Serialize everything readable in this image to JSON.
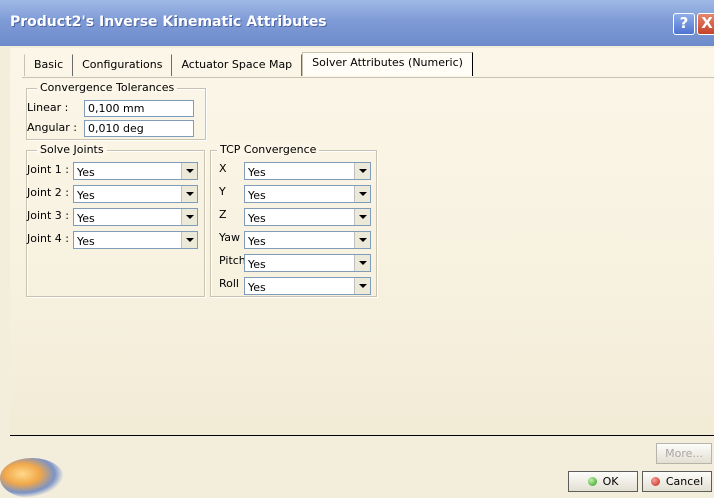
{
  "window": {
    "title": "Product2's Inverse Kinematic Attributes",
    "help_label": "?",
    "close_label": "X"
  },
  "tabs": [
    {
      "label": "Basic",
      "active": false
    },
    {
      "label": "Configurations",
      "active": false
    },
    {
      "label": "Actuator Space Map",
      "active": false
    },
    {
      "label": "Solver Attributes (Numeric)",
      "active": true
    }
  ],
  "convergence": {
    "group_label": "Convergence Tolerances",
    "linear_label": "Linear :",
    "linear_value": "0,100 mm",
    "angular_label": "Angular :",
    "angular_value": "0,010 deg"
  },
  "solve_joints": {
    "group_label": "Solve Joints",
    "items": [
      {
        "label": "Joint 1 :",
        "value": "Yes"
      },
      {
        "label": "Joint 2 :",
        "value": "Yes"
      },
      {
        "label": "Joint 3 :",
        "value": "Yes"
      },
      {
        "label": "Joint 4 :",
        "value": "Yes"
      }
    ]
  },
  "tcp_convergence": {
    "group_label": "TCP Convergence",
    "items": [
      {
        "label": "X",
        "value": "Yes"
      },
      {
        "label": "Y",
        "value": "Yes"
      },
      {
        "label": "Z",
        "value": "Yes"
      },
      {
        "label": "Yaw",
        "value": "Yes"
      },
      {
        "label": "Pitch",
        "value": "Yes"
      },
      {
        "label": "Roll",
        "value": "Yes"
      }
    ]
  },
  "buttons": {
    "more": "More...",
    "ok": "OK",
    "cancel": "Cancel"
  }
}
